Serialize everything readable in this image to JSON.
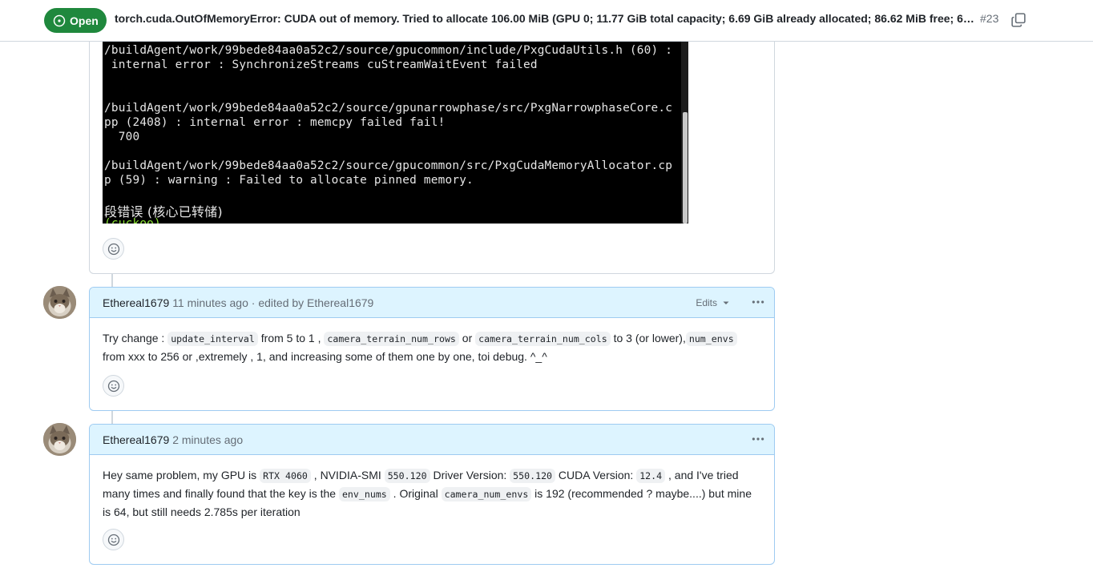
{
  "header": {
    "status": "Open",
    "title": "torch.cuda.OutOfMemoryError: CUDA out of memory. Tried to allocate 106.00 MiB (GPU 0; 11.77 GiB total capacity; 6.69 GiB already allocated; 86.62 MiB free; 6.…",
    "number": "#23",
    "status_color": "#1f883d"
  },
  "terminal": {
    "lines": [
      "/buildAgent/work/99bede84aa0a52c2/source/gpucommon/include/PxgCudaUtils.h (60) :",
      " internal error : SynchronizeStreams cuStreamWaitEvent failed",
      "",
      "",
      "/buildAgent/work/99bede84aa0a52c2/source/gpunarrowphase/src/PxgNarrowphaseCore.c",
      "pp (2408) : internal error : memcpy failed fail!",
      "  700",
      "",
      "/buildAgent/work/99bede84aa0a52c2/source/gpucommon/src/PxgCudaMemoryAllocator.cp",
      "p (59) : warning : Failed to allocate pinned memory.",
      "",
      "段错误 (核心已转储)"
    ]
  },
  "comments": [
    {
      "author": "Ethereal1679",
      "time": "11 minutes ago",
      "edited": "· edited by Ethereal1679",
      "edits_label": "Edits",
      "body": {
        "t1": "Try change : ",
        "c1": "update_interval",
        "t2": " from 5 to 1 , ",
        "c2": "camera_terrain_num_rows",
        "t3": " or ",
        "c3": "camera_terrain_num_cols",
        "t4": " to 3 (or lower),",
        "c4": "num_envs",
        "t5": "from xxx to 256 or ,extremely , 1, and increasing some of them one by one, toi debug. ^_^"
      }
    },
    {
      "author": "Ethereal1679",
      "time": "2 minutes ago",
      "body": {
        "t1": "Hey same problem, my GPU is ",
        "c1": "RTX 4060",
        "t2": " , NVIDIA-SMI ",
        "c2": "550.120",
        "t3": " Driver Version: ",
        "c3": "550.120",
        "t4": " CUDA Version: ",
        "c4": "12.4",
        "t5": " , and I've tried",
        "t6": "many times and finally found that the key is the ",
        "c5": "env_nums",
        "t7": " . Original ",
        "c6": "camera_num_envs",
        "t8": " is 192 (recommended ? maybe....) but mine",
        "t9": "is 64, but still needs 2.785s per iteration"
      }
    }
  ]
}
